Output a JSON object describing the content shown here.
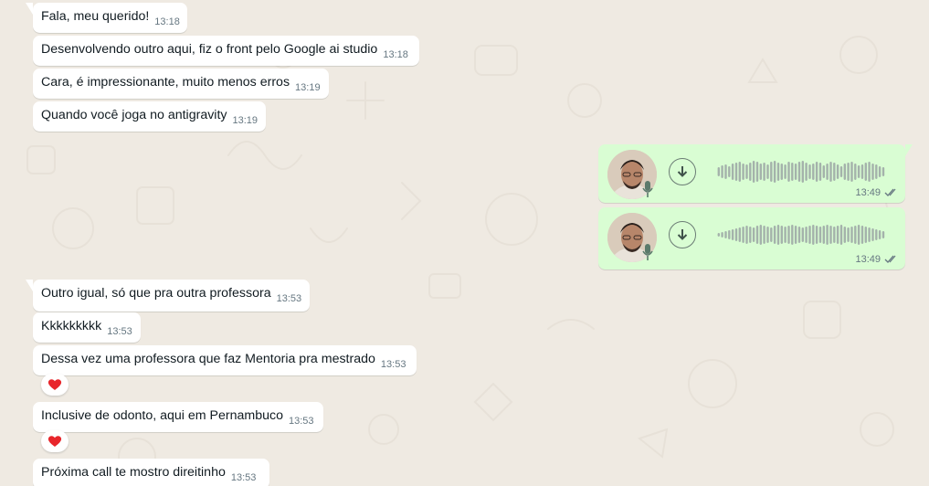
{
  "colors": {
    "background": "#efeae2",
    "incoming_bubble": "#ffffff",
    "outgoing_bubble": "#d9fdd3",
    "timestamp": "#667781",
    "waveform": "#a4b2ab",
    "read_ticks": "#667781",
    "heart": "#e8262b"
  },
  "icons": {
    "download": "download-arrow-icon",
    "mic": "microphone-icon",
    "ticks": "double-check-icon",
    "reaction": "red-heart-emoji"
  },
  "messages_before": [
    {
      "text": "Fala, meu querido!",
      "time": "13:18"
    },
    {
      "text": "Desenvolvendo outro aqui, fiz o front pelo Google ai studio",
      "time": "13:18"
    },
    {
      "text": "Cara, é impressionante, muito menos erros",
      "time": "13:19"
    },
    {
      "text": "Quando você joga no antigravity",
      "time": "13:19"
    }
  ],
  "voice_notes": [
    {
      "time": "13:49",
      "status": "read"
    },
    {
      "time": "13:49",
      "status": "read"
    }
  ],
  "messages_after": [
    {
      "text": "Outro igual, só que pra outra professora",
      "time": "13:53"
    },
    {
      "text": "Kkkkkkkkk",
      "time": "13:53"
    },
    {
      "text": "Dessa vez uma professora que faz Mentoria pra mestrado",
      "time": "13:53",
      "reaction": "❤️"
    },
    {
      "text": "Inclusive de odonto, aqui em Pernambuco",
      "time": "13:53",
      "reaction": "❤️"
    },
    {
      "text": "Próxima call te mostro direitinho",
      "time": "13:53"
    }
  ]
}
